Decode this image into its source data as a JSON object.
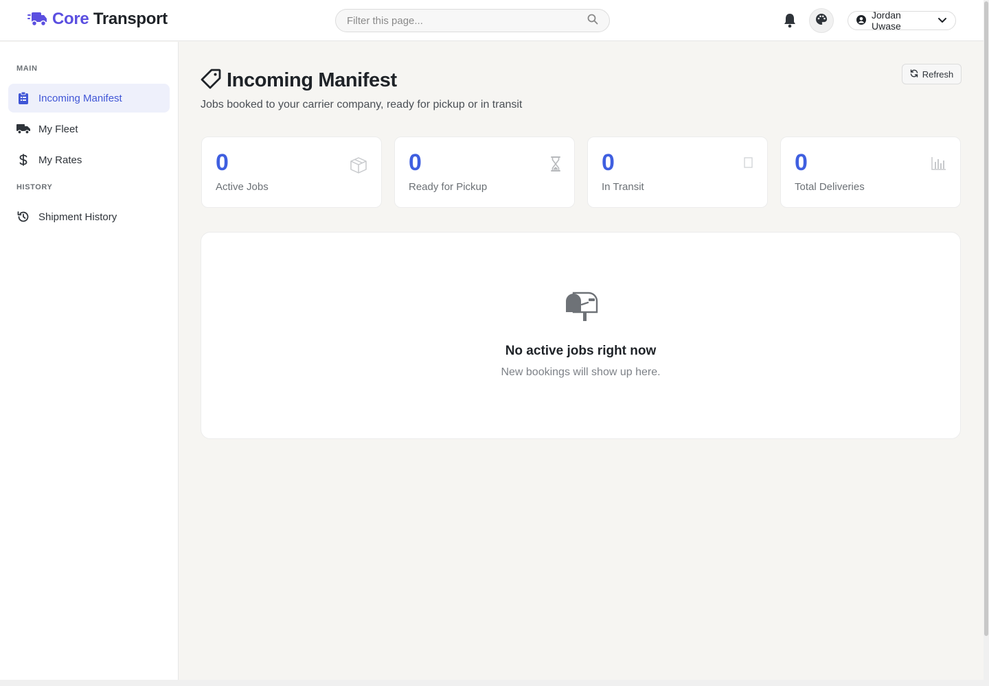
{
  "brand": {
    "part1": "Core",
    "part2": "Transport",
    "accent": "#5b4fe0",
    "icon": "truck-fast-icon"
  },
  "search": {
    "placeholder": "Filter this page..."
  },
  "header": {
    "user_name": "Jordan Uwase"
  },
  "sidebar": {
    "sections": [
      {
        "label": "MAIN",
        "items": [
          {
            "label": "Incoming Manifest",
            "icon": "clipboard-list-icon",
            "active": true
          },
          {
            "label": "My Fleet",
            "icon": "truck-icon",
            "active": false
          },
          {
            "label": "My Rates",
            "icon": "dollar-icon",
            "active": false
          }
        ]
      },
      {
        "label": "HISTORY",
        "items": [
          {
            "label": "Shipment History",
            "icon": "history-icon",
            "active": false
          }
        ]
      }
    ]
  },
  "main": {
    "title": "Incoming Manifest",
    "subtitle": "Jobs booked to your carrier company, ready for pickup or in transit",
    "refresh_label": "Refresh",
    "stats": [
      {
        "value": "0",
        "label": "Active Jobs",
        "icon": "box-icon"
      },
      {
        "value": "0",
        "label": "Ready for Pickup",
        "icon": "hourglass-icon"
      },
      {
        "value": "0",
        "label": "In Transit",
        "icon": "transit-icon"
      },
      {
        "value": "0",
        "label": "Total Deliveries",
        "icon": "bar-chart-icon"
      }
    ],
    "empty_state": {
      "title": "No active jobs right now",
      "subtitle": "New bookings will show up here.",
      "icon": "mailbox-icon"
    }
  },
  "colors": {
    "stat_value": "#3f5fe0",
    "active_nav_bg": "#eef0fb",
    "active_nav_text": "#4056d6"
  }
}
